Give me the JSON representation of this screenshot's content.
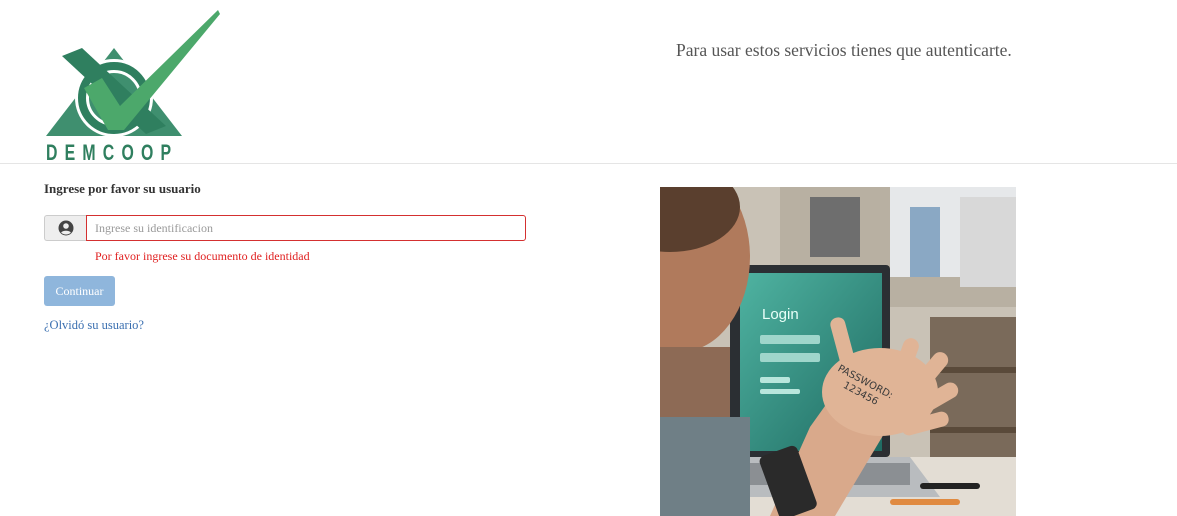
{
  "header": {
    "logo_text": "DEMCOOP",
    "auth_message": "Para usar estos servicios tienes que autenticarte."
  },
  "form": {
    "title": "Ingrese por favor su usuario",
    "user_icon": "user-circle-icon",
    "input_placeholder": "Ingrese su identificacion",
    "input_value": "",
    "error_message": "Por favor ingrese su documento de identidad",
    "continue_label": "Continuar",
    "forgot_label": "¿Olvidó su usuario?"
  },
  "photo": {
    "screen_title": "Login",
    "hand_text_line1": "PASSWORD:",
    "hand_text_line2": "123456"
  },
  "colors": {
    "brand_green": "#2f7f5f",
    "error_red": "#e02020",
    "button_blue": "#8fb6dc",
    "link_blue": "#3a6fb0"
  }
}
